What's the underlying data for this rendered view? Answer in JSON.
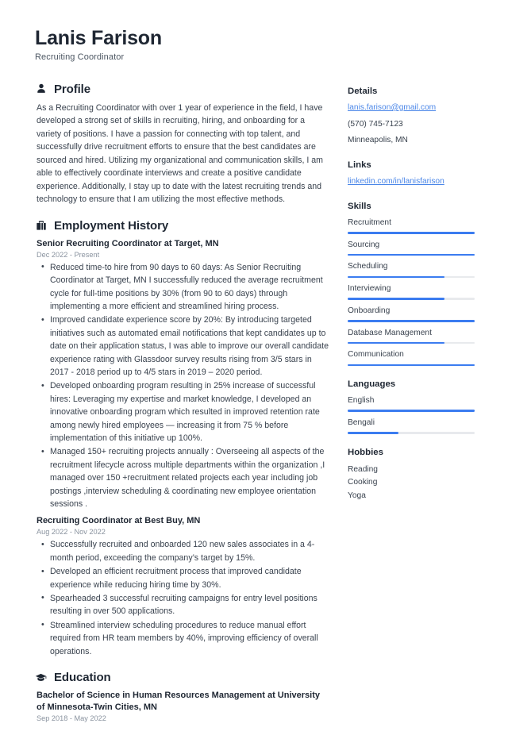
{
  "header": {
    "name": "Lanis Farison",
    "job_title": "Recruiting Coordinator"
  },
  "profile": {
    "icon": "user-icon",
    "title": "Profile",
    "text": "As a Recruiting Coordinator with over 1 year of experience in the field, I have developed a strong set of skills in recruiting, hiring, and onboarding for a variety of positions. I have a passion for connecting with top talent, and successfully drive recruitment efforts to ensure that the best candidates are sourced and hired. Utilizing my organizational and communication skills, I am able to effectively coordinate interviews and create a positive candidate experience. Additionally, I stay up to date with the latest recruiting trends and technology to ensure that I am utilizing the most effective methods."
  },
  "employment": {
    "icon": "briefcase-icon",
    "title": "Employment History",
    "entries": [
      {
        "title": "Senior Recruiting Coordinator at Target, MN",
        "date": "Dec 2022 - Present",
        "bullets": [
          "Reduced time-to hire from 90 days to 60 days: As Senior Recruiting Coordinator at Target, MN I successfully reduced the average recruitment cycle for full-time positions by 30% (from 90 to 60 days) through implementing a more efficient and streamlined hiring process.",
          "Improved candidate experience score by 20%: By introducing targeted initiatives such as automated email notifications that kept candidates up to date on their application status, I was able to improve our overall candidate experience rating with Glassdoor survey results rising from 3/5 stars in 2017 - 2018 period up to 4/5 stars in 2019 – 2020 period.",
          "Developed onboarding program resulting in 25% increase of successful hires: Leveraging my expertise and market knowledge, I developed an innovative onboarding program which resulted in improved retention rate among newly hired employees — increasing it from 75 % before implementation of this initiative up 100%.",
          "Managed 150+ recruiting projects annually : Overseeing all aspects of the recruitment lifecycle across multiple departments within the organization ,I managed over 150 +recruitment related projects each year including job postings ,interview scheduling & coordinating new employee orientation sessions ."
        ]
      },
      {
        "title": "Recruiting Coordinator at Best Buy, MN",
        "date": "Aug 2022 - Nov 2022",
        "bullets": [
          "Successfully recruited and onboarded 120 new sales associates in a 4-month period, exceeding the company’s target by 15%.",
          "Developed an efficient recruitment process that improved candidate experience while reducing hiring time by 30%.",
          "Spearheaded 3 successful recruiting campaigns for entry level positions resulting in over 500 applications.",
          "Streamlined interview scheduling procedures to reduce manual effort required from HR team members by 40%, improving efficiency of overall operations."
        ]
      }
    ]
  },
  "education": {
    "icon": "graduation-cap-icon",
    "title": "Education",
    "entries": [
      {
        "title": "Bachelor of Science in Human Resources Management at University of Minnesota-Twin Cities, MN",
        "date": "Sep 2018 - May 2022"
      }
    ]
  },
  "sidebar": {
    "details": {
      "title": "Details",
      "email": "lanis.farison@gmail.com",
      "phone": "(570) 745-7123",
      "location": "Minneapolis, MN"
    },
    "links": {
      "title": "Links",
      "items": [
        {
          "label": "linkedin.com/in/lanisfarison"
        }
      ]
    },
    "skills": {
      "title": "Skills",
      "items": [
        {
          "label": "Recruitment",
          "level": 100
        },
        {
          "label": "Sourcing",
          "level": 100
        },
        {
          "label": "Scheduling",
          "level": 76
        },
        {
          "label": "Interviewing",
          "level": 76
        },
        {
          "label": "Onboarding",
          "level": 100
        },
        {
          "label": "Database Management",
          "level": 76
        },
        {
          "label": "Communication",
          "level": 100
        }
      ]
    },
    "languages": {
      "title": "Languages",
      "items": [
        {
          "label": "English",
          "level": 100
        },
        {
          "label": "Bengali",
          "level": 40
        }
      ]
    },
    "hobbies": {
      "title": "Hobbies",
      "items": [
        {
          "label": "Reading"
        },
        {
          "label": "Cooking"
        },
        {
          "label": "Yoga"
        }
      ]
    }
  },
  "colors": {
    "accent": "#3b7cf0",
    "link": "#4a86e8",
    "heading": "#1f2733",
    "text": "#39424e",
    "muted": "#8a939f",
    "track": "#e8eaed"
  }
}
